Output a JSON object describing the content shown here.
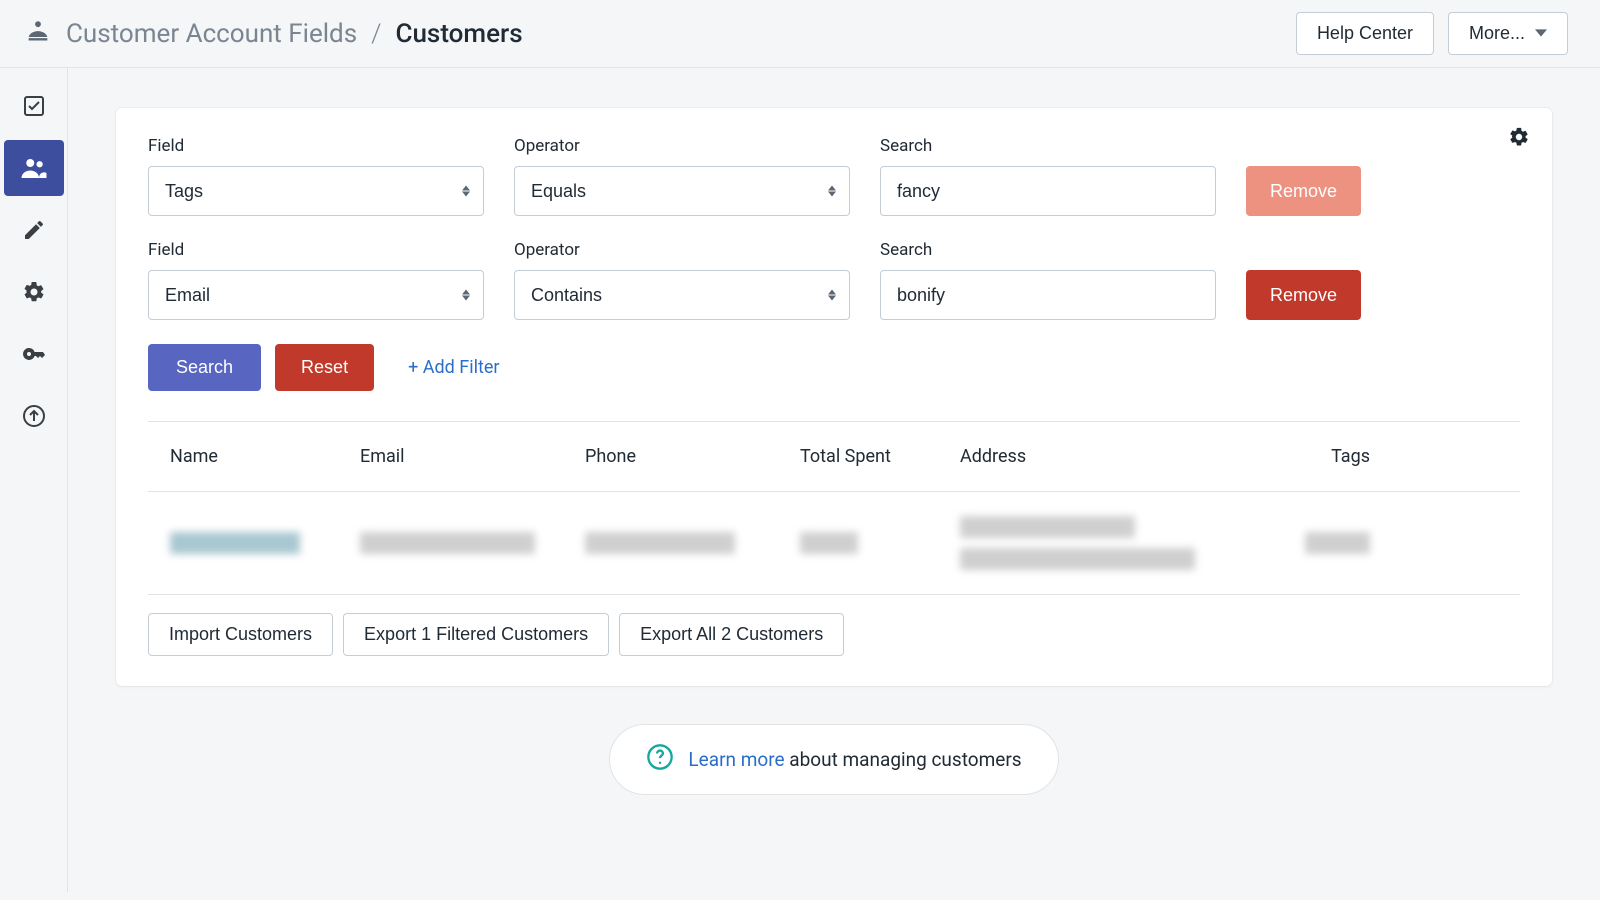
{
  "breadcrumb": {
    "parent": "Customer Account Fields",
    "separator": "/",
    "current": "Customers"
  },
  "header": {
    "help_center": "Help Center",
    "more": "More..."
  },
  "filters": [
    {
      "field_label": "Field",
      "field_value": "Tags",
      "operator_label": "Operator",
      "operator_value": "Equals",
      "search_label": "Search",
      "search_value": "fancy",
      "remove_label": "Remove"
    },
    {
      "field_label": "Field",
      "field_value": "Email",
      "operator_label": "Operator",
      "operator_value": "Contains",
      "search_label": "Search",
      "search_value": "bonify",
      "remove_label": "Remove"
    }
  ],
  "actions": {
    "search": "Search",
    "reset": "Reset",
    "add_filter": "+ Add Filter"
  },
  "table": {
    "headers": {
      "name": "Name",
      "email": "Email",
      "phone": "Phone",
      "total_spent": "Total Spent",
      "address": "Address",
      "tags": "Tags"
    }
  },
  "table_actions": {
    "import": "Import Customers",
    "export_filtered": "Export 1 Filtered Customers",
    "export_all": "Export All 2 Customers"
  },
  "learn": {
    "link": "Learn more",
    "rest": " about managing customers"
  }
}
